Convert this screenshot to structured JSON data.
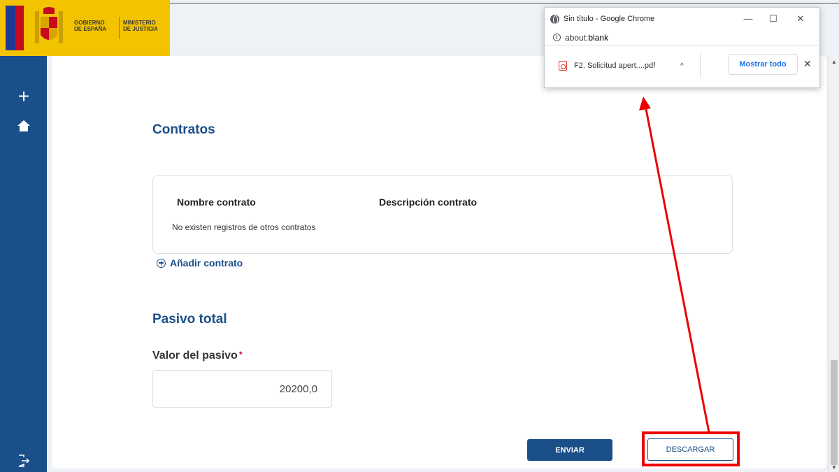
{
  "logo": {
    "gobierno_line1": "GOBIERNO",
    "gobierno_line2": "DE ESPAÑA",
    "ministerio_line1": "MINISTERIO",
    "ministerio_line2": "DE JUSTICIA"
  },
  "sidebar": {
    "icons": [
      "plus-icon",
      "home-icon",
      "logout-icon"
    ]
  },
  "contratos": {
    "title": "Contratos",
    "columns": [
      "Nombre contrato",
      "Descripción contrato"
    ],
    "empty_message": "No existen registros de otros contratos",
    "add_label": "Añadir contrato"
  },
  "pasivo": {
    "title": "Pasivo total",
    "field_label": "Valor del pasivo",
    "required_mark": "*",
    "value": "20200,0"
  },
  "actions": {
    "enviar_label": "ENVIAR",
    "descargar_label": "DESCARGAR"
  },
  "chrome_popup": {
    "window_title": "Sin título - Google Chrome",
    "url_prefix": "about:",
    "url_bold": "blank",
    "download_filename": "F2. Solicitud apert....pdf",
    "show_all_label": "Mostrar todo"
  },
  "colors": {
    "primary": "#1a4f8a",
    "highlight": "#ee0000",
    "logo_yellow": "#f3c300"
  }
}
